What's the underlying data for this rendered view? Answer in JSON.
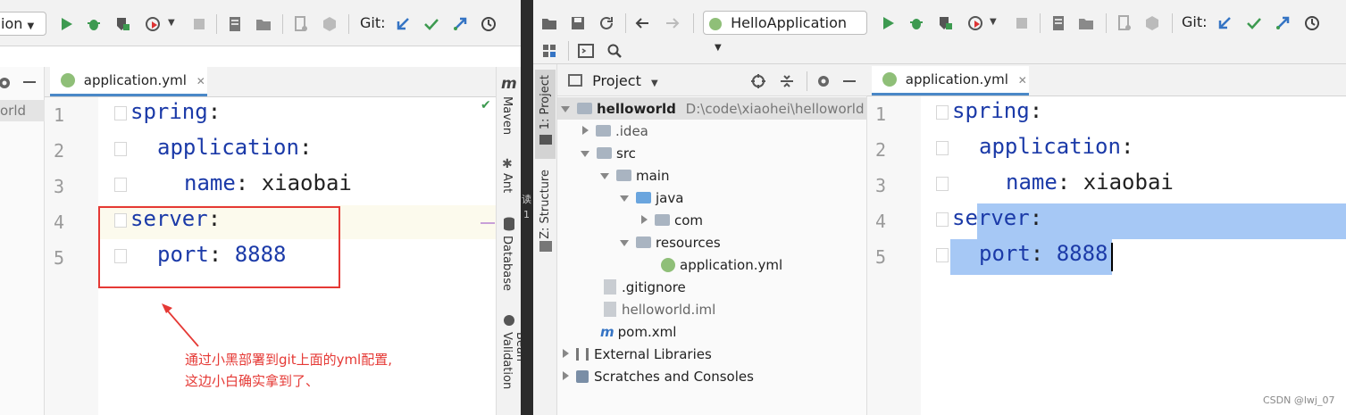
{
  "left": {
    "run_config": "ion",
    "git_label": "Git:",
    "tab_label": "application.yml",
    "project_fragment": "orld",
    "maven_label": "Maven",
    "ant_label": "Ant",
    "database_label": "Database",
    "bean_label": "Bean Validation",
    "line_numbers": [
      "1",
      "2",
      "3",
      "4",
      "5"
    ],
    "code": [
      {
        "key": "spring",
        "sep": ":",
        "value": ""
      },
      {
        "key": "application",
        "sep": ":",
        "value": ""
      },
      {
        "key": "name",
        "sep": ": ",
        "value": "xiaobai"
      },
      {
        "key": "server",
        "sep": ":",
        "value": ""
      },
      {
        "key": "port",
        "sep": ": ",
        "value": "8888"
      }
    ],
    "annotation_line1": "通过小黑部署到git上面的yml配置,",
    "annotation_line2": "这边小白确实拿到了、",
    "annotation_color": "#e53935"
  },
  "divider": {
    "text1": "读",
    "text2": "1"
  },
  "right": {
    "run_config": "HelloApplication",
    "git_label": "Git:",
    "project_label": "Project",
    "side_project": "1: Project",
    "side_structure": "Z: Structure",
    "tab_label": "application.yml",
    "tree": [
      {
        "name": "helloworld",
        "extra": "D:\\code\\xiaohei\\helloworld"
      },
      {
        "name": ".idea"
      },
      {
        "name": "src"
      },
      {
        "name": "main"
      },
      {
        "name": "java"
      },
      {
        "name": "com"
      },
      {
        "name": "resources"
      },
      {
        "name": "application.yml"
      },
      {
        "name": ".gitignore"
      },
      {
        "name": "helloworld.iml"
      },
      {
        "name": "pom.xml"
      },
      {
        "name": "External Libraries"
      },
      {
        "name": "Scratches and Consoles"
      }
    ],
    "line_numbers": [
      "1",
      "2",
      "3",
      "4",
      "5"
    ],
    "code": [
      {
        "key": "spring",
        "sep": ":",
        "value": ""
      },
      {
        "key": "application",
        "sep": ":",
        "value": ""
      },
      {
        "key": "name",
        "sep": ": ",
        "value": "xiaobai"
      },
      {
        "key": "server",
        "sep": ":",
        "value": ""
      },
      {
        "key": "port",
        "sep": ": ",
        "value": "8888"
      }
    ],
    "selection_color": "#a6c8f5",
    "watermark": "CSDN @lwj_07"
  }
}
